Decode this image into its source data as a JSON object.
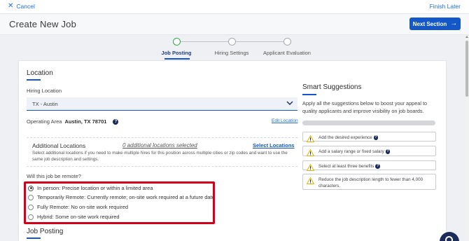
{
  "topbar": {
    "cancel_label": "Cancel",
    "finish_label": "Finish Later"
  },
  "header": {
    "title": "Create New Job",
    "next_label": "Next Section"
  },
  "stepper": {
    "steps": [
      {
        "label": "Job Posting",
        "active": true
      },
      {
        "label": "Hiring Settings",
        "active": false
      },
      {
        "label": "Applicant Evaluation",
        "active": false
      }
    ]
  },
  "location": {
    "section_title": "Location",
    "hiring_location_label": "Hiring Location",
    "hiring_location_value": "TX - Austin",
    "operating_area_label": "Operating Area",
    "operating_area_value": "Austin, TX 78701",
    "edit_location_label": "Edit Location",
    "additional_title": "Additional Locations",
    "additional_count": "0 additional locations selected",
    "select_locations_label": "Select Locations",
    "additional_desc": "Select additional locations if you need to make multiple hires for this position across multiple cities or zip codes and want to use the same job description and settings.",
    "remote_question": "Will this job be remote?",
    "remote_options": [
      {
        "label": "In person: Precise location or within a limited area",
        "checked": true
      },
      {
        "label": "Temporarily Remote: Currently remote; on-site work required at a future date",
        "checked": false
      },
      {
        "label": "Fully Remote: No on-site work required",
        "checked": false
      },
      {
        "label": "Hybrid: Some on-site work required",
        "checked": false
      }
    ]
  },
  "job_posting": {
    "section_title": "Job Posting"
  },
  "smart": {
    "title": "Smart Suggestions",
    "desc": "Apply all the suggestions below to boost your appeal to quality applicants and improve visibility on job boards.",
    "progress": 0,
    "items": [
      "Add the desired experience",
      "Add a salary range or fixed salary",
      "Select at least three benefits",
      "Reduce the job description length to fewer than 4,000 characters."
    ]
  },
  "icons": {
    "cancel": "close-icon",
    "next": "arrow-right-icon",
    "dropdown": "chevron-down-icon",
    "help": "help-icon",
    "warning": "warning-icon",
    "chat": "chat-icon"
  },
  "colors": {
    "accent": "#1457c9",
    "highlight": "#d4001a",
    "success": "#2ea84a",
    "warning": "#e9b300"
  }
}
